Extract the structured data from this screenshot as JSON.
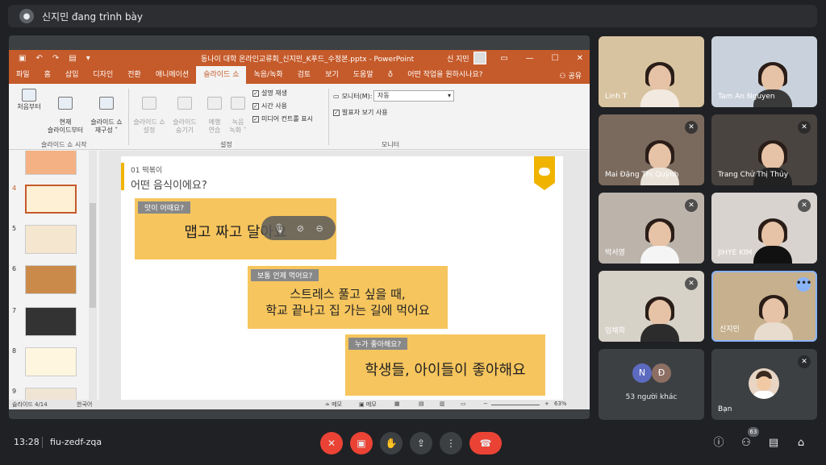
{
  "presenter_bar": {
    "text": "신지민 đang trình bày"
  },
  "powerpoint": {
    "title_bar": {
      "document": "동나이 대학 온라인교류회_신지민_K푸드_수정본.pptx  -  PowerPoint",
      "user": "신 지민"
    },
    "tabs": [
      {
        "label": "파일"
      },
      {
        "label": "홈"
      },
      {
        "label": "삽입"
      },
      {
        "label": "디자인"
      },
      {
        "label": "전환"
      },
      {
        "label": "애니메이션"
      },
      {
        "label": "슬라이드 쇼",
        "active": true
      },
      {
        "label": "녹음/녹화"
      },
      {
        "label": "검토"
      },
      {
        "label": "보기"
      },
      {
        "label": "도움말"
      },
      {
        "label": "어떤 작업을 원하시나요?"
      }
    ],
    "share": "공유",
    "ribbon": {
      "from_start": "처음부터",
      "from_current": "현재\n슬라이드부터",
      "custom_show": "슬라이드 쇼\n재구성 ˅",
      "group_start": "슬라이드 쇼 시작",
      "setup": "슬라이드 쇼\n설정",
      "hide_slide": "슬라이드\n숨기기",
      "rehearse": "예행\n연습",
      "record": "녹음\n녹화 ˅",
      "check_narration": "설명 재생",
      "check_timings": "시간 사용",
      "check_media": "미디어 컨트롤 표시",
      "group_setup": "설정",
      "monitor_label": "모니터(M):",
      "monitor_value": "자동",
      "presenter_view": "발표자 보기 사용",
      "group_monitor": "모니터"
    },
    "thumbnails": [
      {
        "num": "4",
        "selected": true
      },
      {
        "num": "5"
      },
      {
        "num": "6"
      },
      {
        "num": "7"
      },
      {
        "num": "8"
      },
      {
        "num": "9"
      }
    ],
    "slide": {
      "number_title": "01 떡볶이",
      "question": "어떤 음식이에요?",
      "card1": {
        "label": "맛이 어때요?",
        "text": "맵고 짜고 달아요"
      },
      "card2": {
        "label": "보통 언제 먹어요?",
        "line1": "스트레스 풀고 싶을 때,",
        "line2": "학교 끝나고 집 가는 길에 먹어요"
      },
      "card3": {
        "label": "누가 좋아해요?",
        "text": "학생들, 아이들이 좋아해요"
      }
    },
    "status_bar": {
      "slide_info": "슬라이드 4/14",
      "language": "한국어",
      "notes": "≐ 메모",
      "memo": "▣ 메모",
      "zoom": "63%"
    }
  },
  "participants": [
    {
      "name": "Linh T",
      "muted": false
    },
    {
      "name": "Tam An Nguyen",
      "muted": false
    },
    {
      "name": "Mai Đặng Thị Quỳnh",
      "muted": true
    },
    {
      "name": "Trang Chử Thị Thủy",
      "muted": true
    },
    {
      "name": "박서영",
      "muted": true
    },
    {
      "name": "JIHYE KIM",
      "muted": true
    },
    {
      "name": "임채희",
      "muted": true
    },
    {
      "name": "신지민",
      "muted": false
    }
  ],
  "others_tile": {
    "avatar1": "N",
    "avatar2": "Đ",
    "count_text": "53 người khác"
  },
  "self_tile": {
    "name": "Bạn"
  },
  "bottom_bar": {
    "time": "13:28",
    "meeting_code": "fiu-zedf-zqa",
    "participant_count": "63"
  },
  "colors": {
    "ppt_accent": "#c55a2a",
    "slide_card": "#f6c55d",
    "end_call": "#ea4335",
    "active_speaker": "#8ab4f8"
  }
}
